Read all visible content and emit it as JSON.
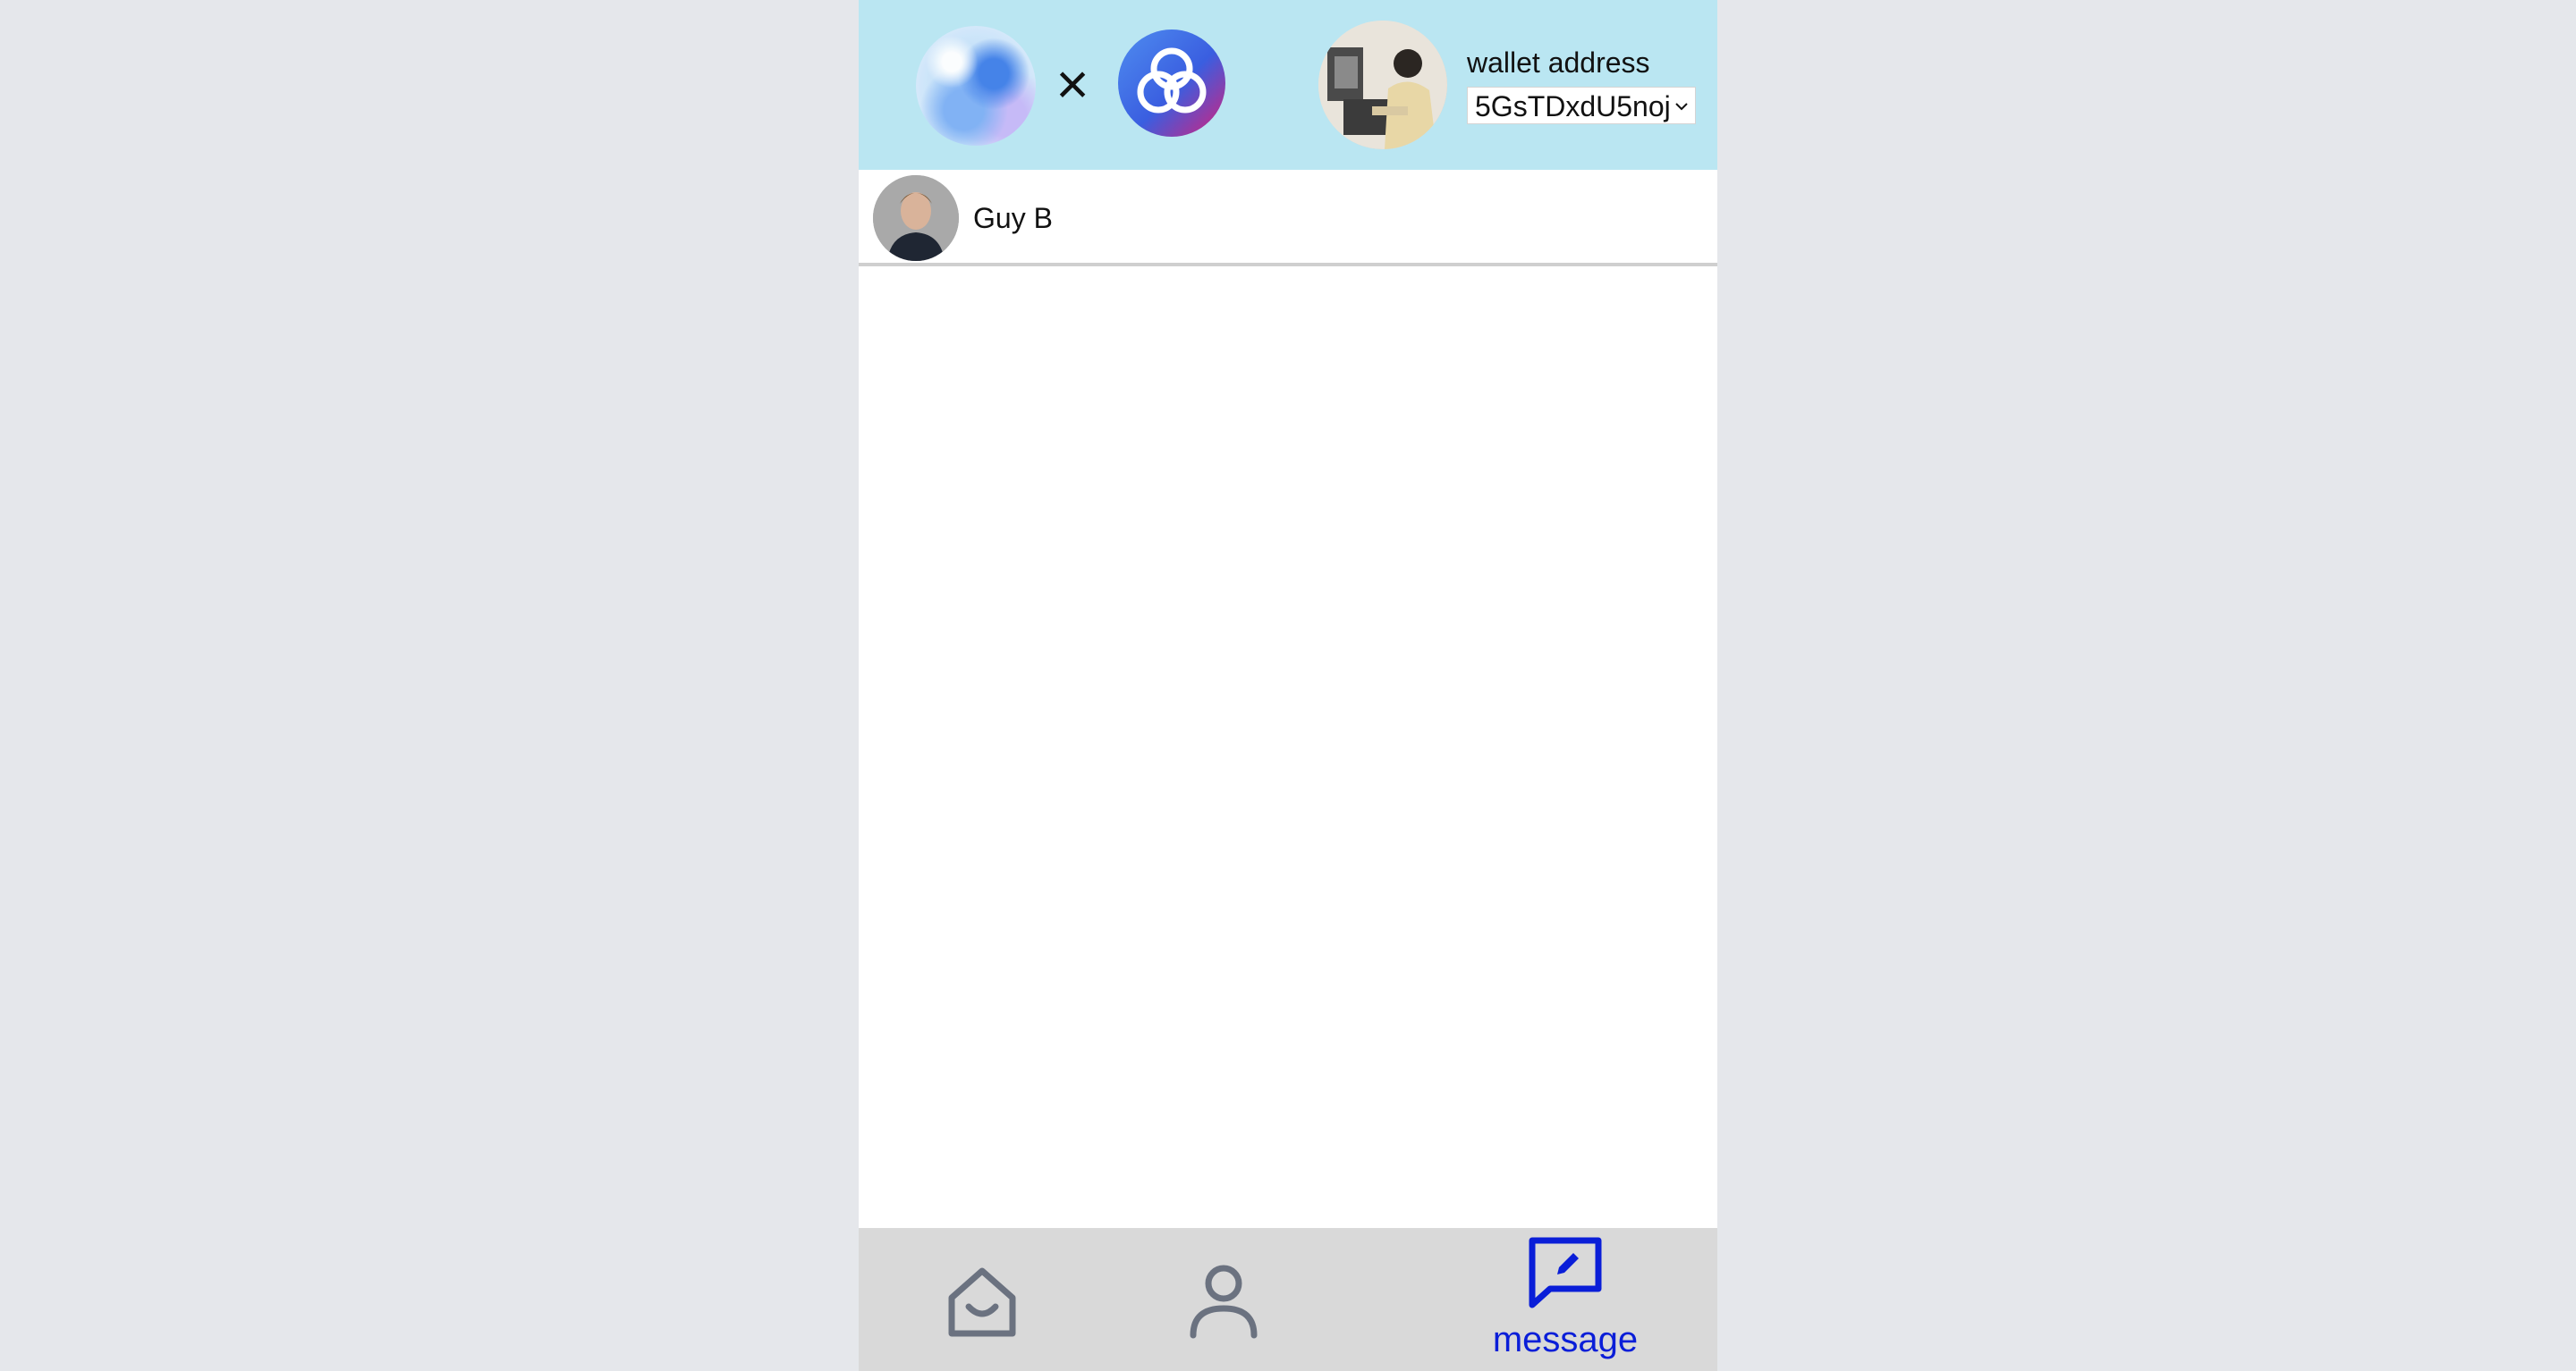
{
  "header": {
    "logo_left_icon": "gradient-sphere-logo-icon",
    "separator": "×",
    "logo_right_icon": "knot-logo-icon",
    "wallet_label": "wallet address",
    "wallet_selected": "5GsTDxdU5noj"
  },
  "contacts": [
    {
      "name": "Guy B"
    }
  ],
  "nav": {
    "items": [
      {
        "icon": "home-icon",
        "label": ""
      },
      {
        "icon": "user-icon",
        "label": ""
      },
      {
        "icon": "message-edit-icon",
        "label": "message"
      }
    ],
    "active_color": "#0a1ed8",
    "inactive_color": "#6b7280"
  },
  "colors": {
    "header_bg": "#bae6f2",
    "page_bg": "#e5e7eb",
    "nav_bg": "#d9d9d9"
  }
}
